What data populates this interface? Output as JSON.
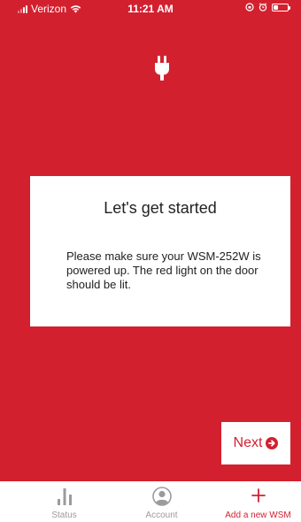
{
  "status_bar": {
    "carrier": "Verizon",
    "time": "11:21 AM",
    "battery_level": 0.3
  },
  "colors": {
    "brand_red": "#d3202f",
    "tab_inactive": "#9b9b9b"
  },
  "header_icon": "plug-icon",
  "card": {
    "title": "Let's get started",
    "body": "Please make sure your WSM-252W is powered up. The red light on the door should be lit."
  },
  "next_button": {
    "label": "Next",
    "icon": "arrow-circle-right-icon"
  },
  "tab_bar": {
    "tabs": [
      {
        "label": "Status",
        "icon": "bar-chart-icon",
        "active": false
      },
      {
        "label": "Account",
        "icon": "user-circle-icon",
        "active": false
      },
      {
        "label": "Add a new WSM",
        "icon": "plus-icon",
        "active": true
      }
    ]
  }
}
